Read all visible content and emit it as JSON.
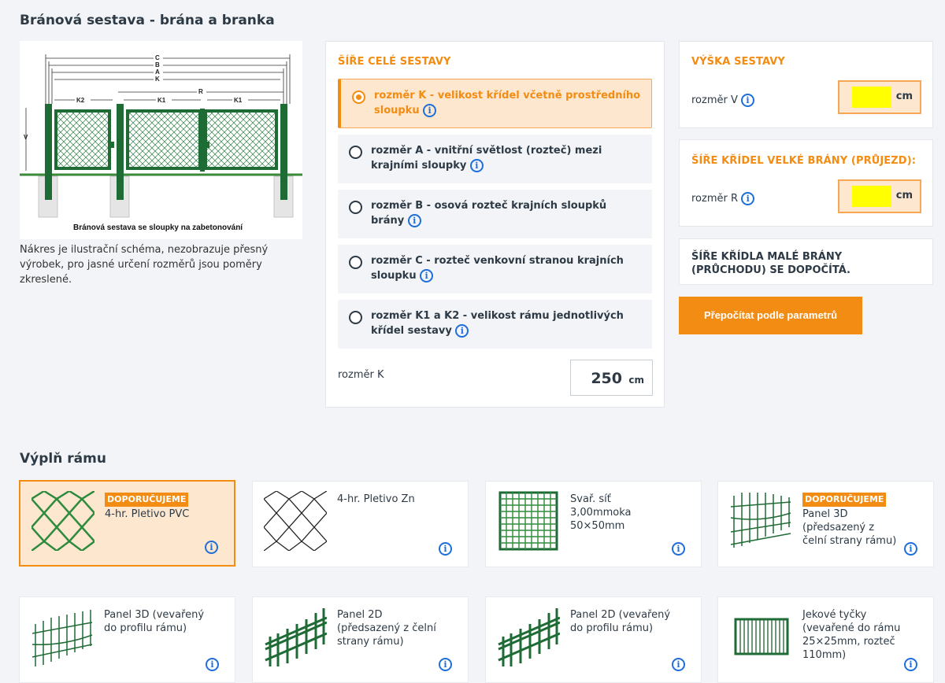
{
  "header": {
    "title": "Bránová sestava - brána a branka"
  },
  "diagram": {
    "dim_labels": [
      "C",
      "B",
      "A",
      "K",
      "R",
      "K2",
      "K1",
      "K1",
      "V"
    ],
    "caption": "Bránová sestava se sloupky na zabetonování",
    "note": "Nákres je ilustrační schéma, nezobrazuje přesný výrobek, pro jasné určení rozměrů jsou poměry zkreslené."
  },
  "width_section": {
    "heading": "ŠÍŘE CELÉ SESTAVY",
    "options": [
      {
        "label": "rozměr K - velikost křídel včetně prostředního sloupku",
        "selected": true
      },
      {
        "label": "rozměr A - vnitřní světlost (rozteč) mezi krajními sloupky",
        "selected": false
      },
      {
        "label": "rozměr B - osová rozteč krajních sloupků brány",
        "selected": false
      },
      {
        "label": "rozměr C - rozteč venkovní stranou krajních sloupku",
        "selected": false
      },
      {
        "label": "rozměr K1 a K2 - velikost rámu jednotlivých křídel sestavy",
        "selected": false
      }
    ],
    "value_label": "rozměr K",
    "value": "250",
    "unit": "cm"
  },
  "height_section": {
    "heading": "VÝŠKA SESTAVY",
    "label": "rozměr V",
    "unit": "cm"
  },
  "wing_section": {
    "heading": "ŠÍŘE KŘÍDEL VELKÉ BRÁNY (PRŮJEZD):",
    "label": "rozměr R",
    "unit": "cm"
  },
  "small_gate": {
    "text": "ŠÍŘE KŘÍDLA MALÉ BRÁNY (PRŮCHODU) SE DOPOČÍTÁ."
  },
  "recalc_button": "Přepočítat podle parametrů",
  "info_glyph": "i",
  "fill": {
    "title": "Výplň rámu",
    "tiles": [
      {
        "badge": "DOPORUČUJEME",
        "name": "4-hr. Pletivo PVC",
        "icon": "chain-link-pvc-icon",
        "selected": true
      },
      {
        "badge": "",
        "name": "4-hr. Pletivo Zn",
        "icon": "chain-link-zn-icon",
        "selected": false
      },
      {
        "badge": "",
        "name": "Svař. síť 3,00mmoka 50×50mm",
        "icon": "welded-mesh-icon",
        "selected": false
      },
      {
        "badge": "DOPORUČUJEME",
        "name": "Panel 3D (předsazený z čelní strany rámu)",
        "icon": "panel-3d-icon",
        "selected": false
      },
      {
        "badge": "",
        "name": "Panel 3D (vevařený do profilu rámu)",
        "icon": "panel-3d-icon",
        "selected": false
      },
      {
        "badge": "",
        "name": "Panel 2D (předsazený z čelní strany rámu)",
        "icon": "panel-2d-icon",
        "selected": false
      },
      {
        "badge": "",
        "name": "Panel 2D (vevařený do profilu rámu)",
        "icon": "panel-2d-icon",
        "selected": false
      },
      {
        "badge": "",
        "name": "Jekové tyčky (vevařené do rámu 25×25mm, rozteč 110mm)",
        "icon": "bars-icon",
        "selected": false
      }
    ]
  },
  "colors": {
    "accent": "#f28c13",
    "info": "#1e6fd9",
    "frame_green": "#1f6b35",
    "highlight": "#ffff00"
  }
}
